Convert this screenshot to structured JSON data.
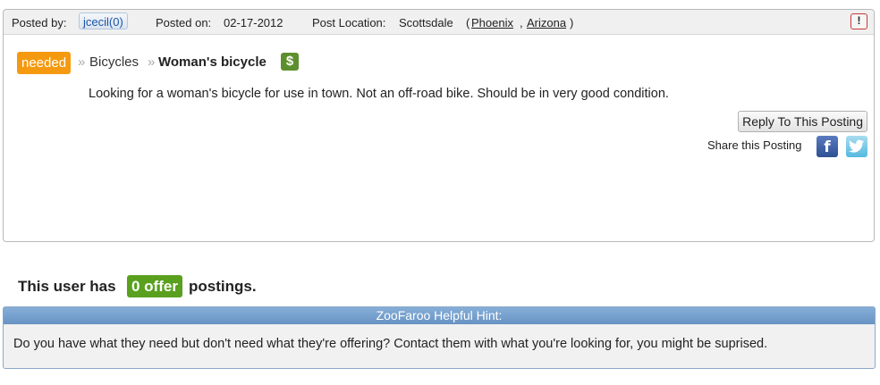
{
  "posting": {
    "meta": {
      "posted_by_label": "Posted by:",
      "user_name": "jcecil(0)",
      "posted_on_label": "Posted on:",
      "posted_on_date": "02-17-2012",
      "location_label": "Post Location:",
      "location_city": "Scottsdale",
      "open_paren": "(",
      "region_link": "Phoenix",
      "comma": ",",
      "state_link": "Arizona",
      "close_paren": ")",
      "flag_label": "!"
    },
    "breadcrumb": {
      "type_tag": "needed",
      "separator": "»",
      "category": "Bicycles",
      "title": "Woman's bicycle",
      "price_icon": "$"
    },
    "description": "Looking for a woman's bicycle for use in town. Not an off-road bike. Should be in very good condition.",
    "reply_button": "Reply To This Posting",
    "share_label": "Share this Posting",
    "facebook_glyph": "f",
    "icons": [
      "flag-icon",
      "dollar-icon",
      "facebook-icon",
      "twitter-icon"
    ]
  },
  "user_summary": {
    "prefix": "This user has",
    "badge": "0  offer",
    "suffix": "postings."
  },
  "hint": {
    "title": "ZooFaroo Helpful Hint:",
    "text": "Do you have what they need but don't need what they're offering?  Contact them with what you're looking for, you might be suprised."
  },
  "colors": {
    "needed_tag": "#f59a10",
    "offer_badge": "#5aa01f",
    "price_icon": "#5e8f2e",
    "hint_header": "#6793c3",
    "link": "#1f5db8",
    "flag_border": "#c9393a"
  }
}
